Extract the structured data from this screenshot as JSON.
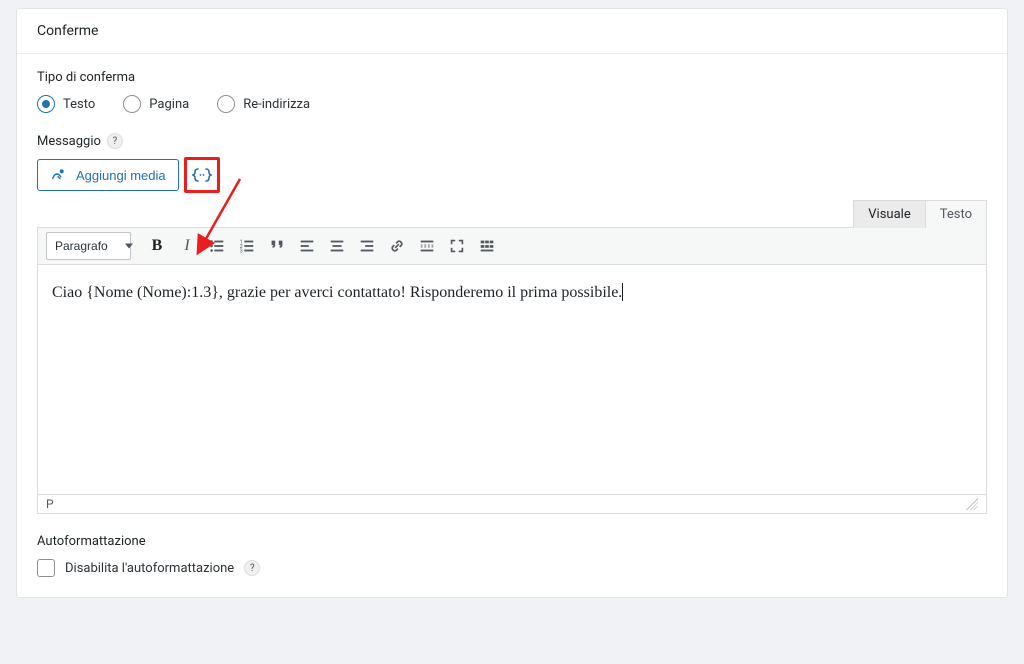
{
  "panel": {
    "title": "Conferme"
  },
  "confirmType": {
    "label": "Tipo di conferma",
    "options": {
      "text": "Testo",
      "page": "Pagina",
      "redirect": "Re-indirizza"
    },
    "selected": "text"
  },
  "message": {
    "label": "Messaggio",
    "addMediaLabel": "Aggiungi media",
    "tabs": {
      "visual": "Visuale",
      "text": "Testo"
    },
    "formatSelect": "Paragrafo",
    "content": "Ciao {Nome (Nome):1.3}, grazie per averci contattato! Risponderemo il prima possibile.",
    "path": "P"
  },
  "autoformat": {
    "label": "Autoformattazione",
    "checkboxLabel": "Disabilita l'autoformattazione"
  },
  "colors": {
    "accent": "#2271b1",
    "highlight": "#e91e1e"
  }
}
